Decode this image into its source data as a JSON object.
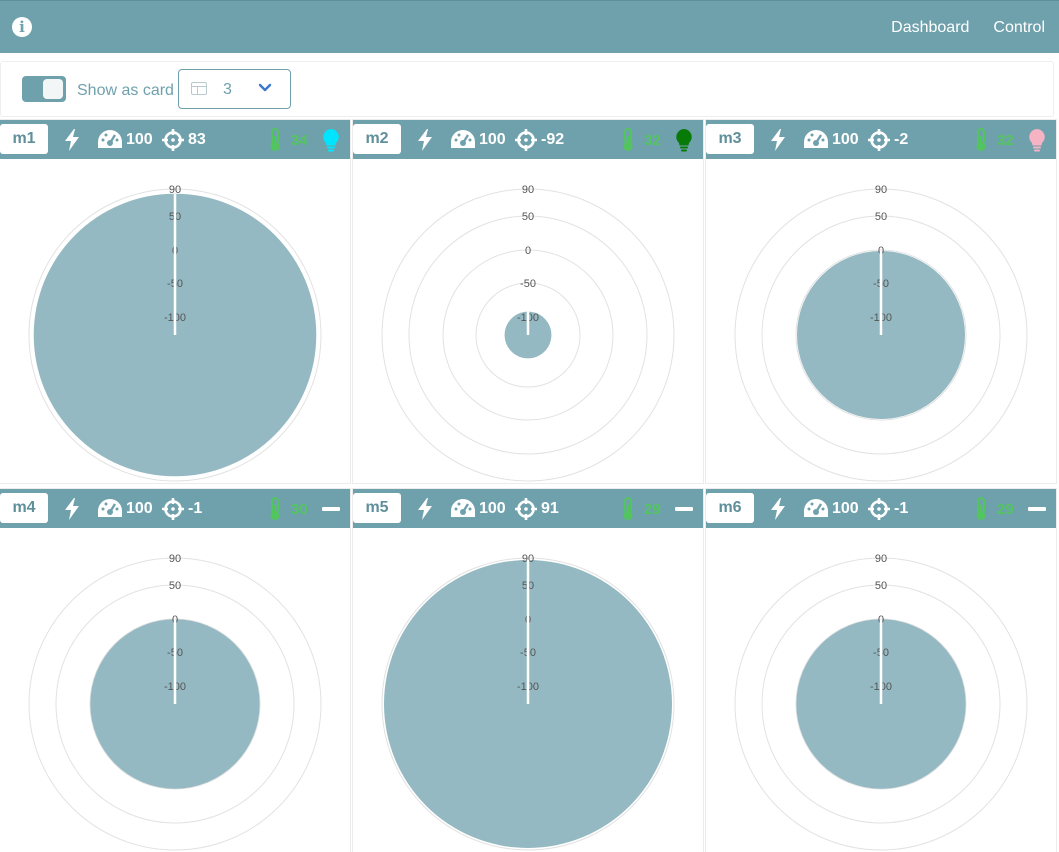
{
  "header": {
    "nav": [
      "Dashboard",
      "Control"
    ]
  },
  "toolbar": {
    "toggle_label": "Show as card",
    "toggle_on": true,
    "columns_value": "3"
  },
  "polar_axis": {
    "rings": [
      "90",
      "50",
      "0",
      "-50",
      "-100"
    ],
    "min": -100,
    "max": 90
  },
  "colors": {
    "header": "#6fa1ad",
    "fill": "#93b8c1",
    "temperature": "#53c55f",
    "bulb_cyan": "#00e5ff",
    "bulb_green": "#087a08",
    "bulb_pink": "#f5b3c3"
  },
  "motors": [
    {
      "name": "m1",
      "speed": "100",
      "angle": "83",
      "temperature": "34",
      "status_icon": "lightbulb-icon",
      "bulb_color": "#00e5ff"
    },
    {
      "name": "m2",
      "speed": "100",
      "angle": "-92",
      "temperature": "32",
      "status_icon": "lightbulb-icon",
      "bulb_color": "#087a08"
    },
    {
      "name": "m3",
      "speed": "100",
      "angle": "-2",
      "temperature": "32",
      "status_icon": "lightbulb-icon",
      "bulb_color": "#f5b3c3"
    },
    {
      "name": "m4",
      "speed": "100",
      "angle": "-1",
      "temperature": "30",
      "status_icon": "minus-icon",
      "bulb_color": "#ffffff"
    },
    {
      "name": "m5",
      "speed": "100",
      "angle": "91",
      "temperature": "29",
      "status_icon": "minus-icon",
      "bulb_color": "#ffffff"
    },
    {
      "name": "m6",
      "speed": "100",
      "angle": "-1",
      "temperature": "29",
      "status_icon": "minus-icon",
      "bulb_color": "#ffffff"
    }
  ]
}
